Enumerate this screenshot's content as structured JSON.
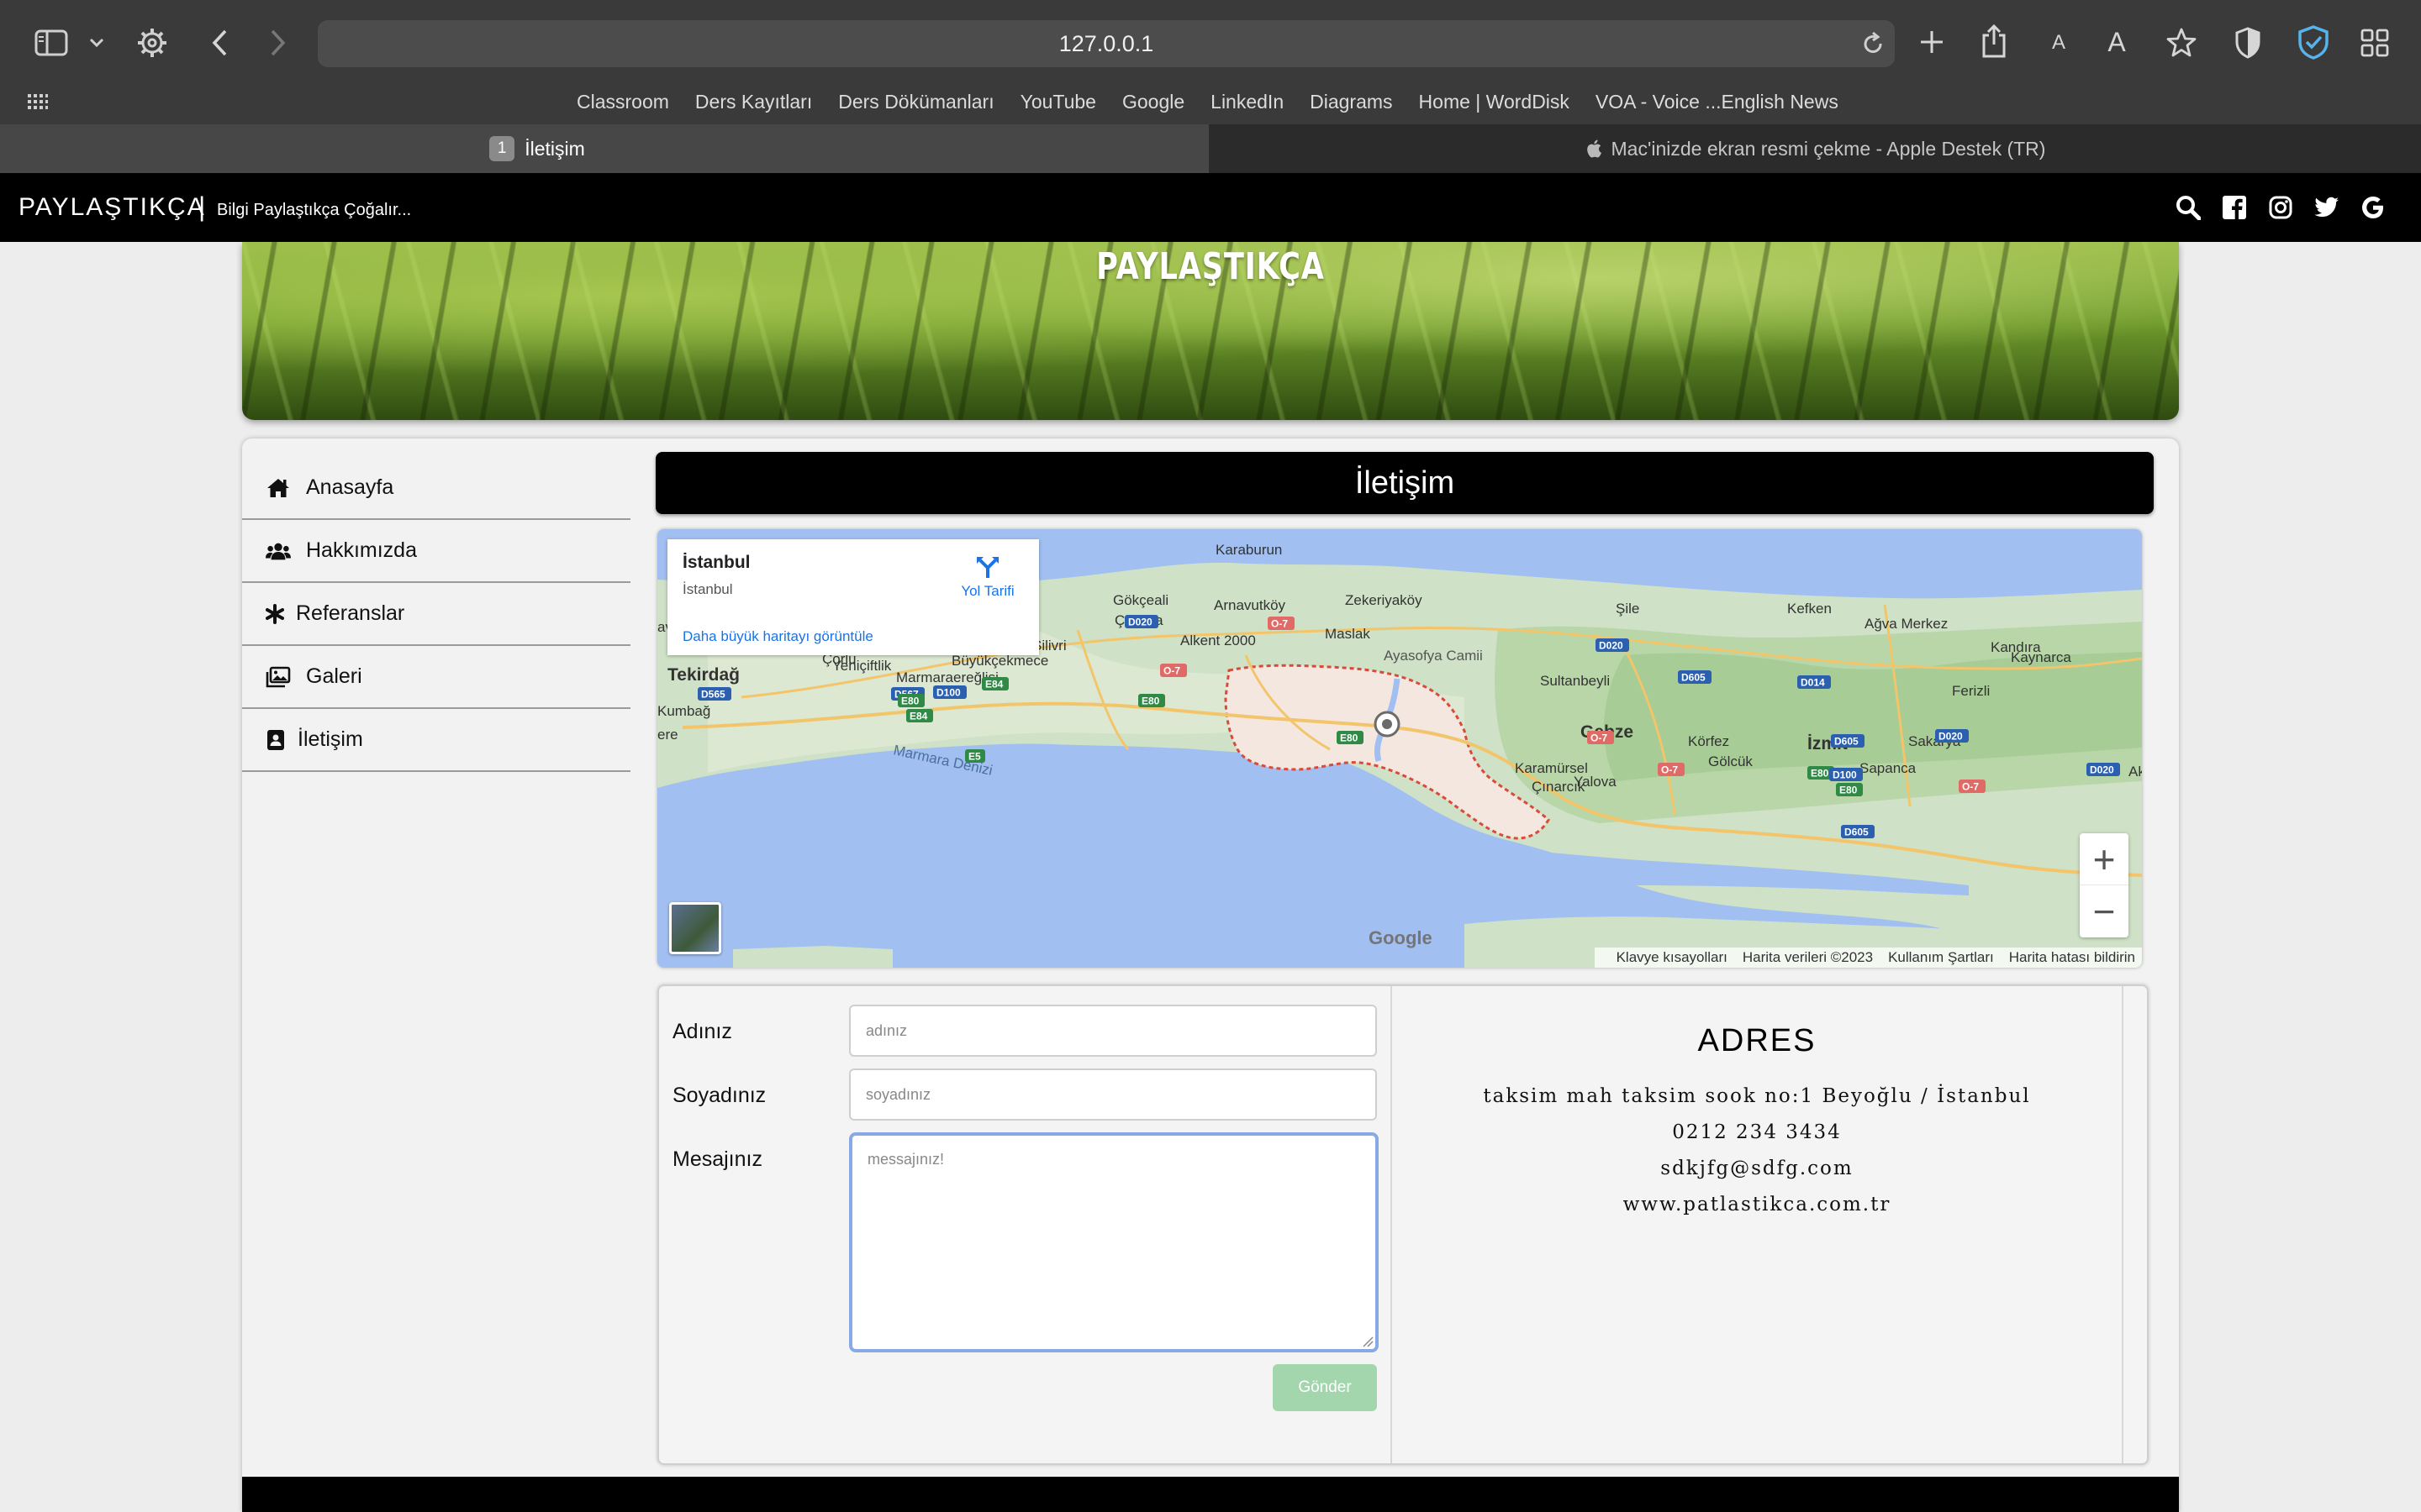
{
  "browser": {
    "url": "127.0.0.1",
    "bookmarks": [
      "Classroom",
      "Ders Kayıtları",
      "Ders Dökümanları",
      "YouTube",
      "Google",
      "LinkedIn",
      "Diagrams",
      "Home | WordDisk",
      "VOA - Voice ...English News"
    ],
    "tabs": [
      {
        "number": "1",
        "label": "İletişim"
      },
      {
        "label": "Mac'inizde ekran resmi çekme - Apple Destek (TR)"
      }
    ],
    "toolbar_text_small": "A",
    "toolbar_text_large": "A"
  },
  "site": {
    "brand": "PAYLAŞTIKÇA",
    "brand_separator": "|",
    "slogan": "Bilgi Paylaştıkça Çoğalır...",
    "banner_title": "PAYLAŞTIKÇA",
    "social_icons": [
      "search-icon",
      "facebook-icon",
      "instagram-icon",
      "twitter-icon",
      "google-icon"
    ]
  },
  "sidebar": {
    "items": [
      {
        "label": "Anasayfa",
        "icon": "home-icon"
      },
      {
        "label": "Hakkımızda",
        "icon": "users-icon"
      },
      {
        "label": "Referanslar",
        "icon": "asterisk-icon"
      },
      {
        "label": "Galeri",
        "icon": "images-icon"
      },
      {
        "label": "İletişim",
        "icon": "contact-icon"
      }
    ]
  },
  "page": {
    "title": "İletişim"
  },
  "map": {
    "card_title": "İstanbul",
    "card_subtitle": "İstanbul",
    "directions": "Yol Tarifi",
    "larger_map": "Daha büyük haritayı görüntüle",
    "google": "Google",
    "attribution": [
      "Klavye kısayolları",
      "Harita verileri ©2023",
      "Kullanım Şartları",
      "Harita hatası bildirin"
    ],
    "labels": [
      "Karaburun",
      "Gökçeali",
      "Arnavutköy",
      "Zekeriyaköy",
      "Şile",
      "Kefken",
      "Ağva Merkez",
      "Çorlu",
      "Çatalca",
      "Maslak",
      "Kandıra",
      "Kaynarca",
      "Silivri",
      "Alkent 2000",
      "Ayasofya Camii",
      "Yeniçiftlik",
      "Büyükçekmece",
      "Sultanbeyli",
      "Tekirdağ",
      "Marmaraereğlisi",
      "Ferizli",
      "Kumbağ",
      "Gebze",
      "Körfez",
      "İzmit",
      "Sakarya",
      "Marmara Denizi",
      "Karamürsel",
      "Gölcük",
      "Sapanca",
      "Yalova",
      "Çınarcık",
      "avuz",
      "ere",
      "Aky"
    ],
    "road_labels": [
      "D020",
      "O-7",
      "D020",
      "D605",
      "D014",
      "D565",
      "D567",
      "D100",
      "E84",
      "E80",
      "E80",
      "O-7",
      "E5",
      "E80",
      "O-7",
      "D605",
      "D020",
      "O-7",
      "E80",
      "D100",
      "E80",
      "O-7",
      "D605",
      "D020",
      "E84"
    ]
  },
  "form": {
    "first_name_label": "Adınız",
    "first_name_placeholder": "adınız",
    "last_name_label": "Soyadınız",
    "last_name_placeholder": "soyadınız",
    "message_label": "Mesajınız",
    "message_placeholder": "messajınız!",
    "submit": "Gönder"
  },
  "address": {
    "title": "ADRES",
    "line1": "taksim mah taksim sook no:1 Beyoğlu / İstanbul",
    "phone": "0212 234 3434",
    "email": "sdkjfg@sdfg.com",
    "website": "www.patlastikca.com.tr"
  },
  "colors": {
    "accent": "#1a73e8",
    "send_button": "#a3d6ad",
    "textarea_focus": "#88a9e4",
    "nav_bg": "#000000"
  }
}
